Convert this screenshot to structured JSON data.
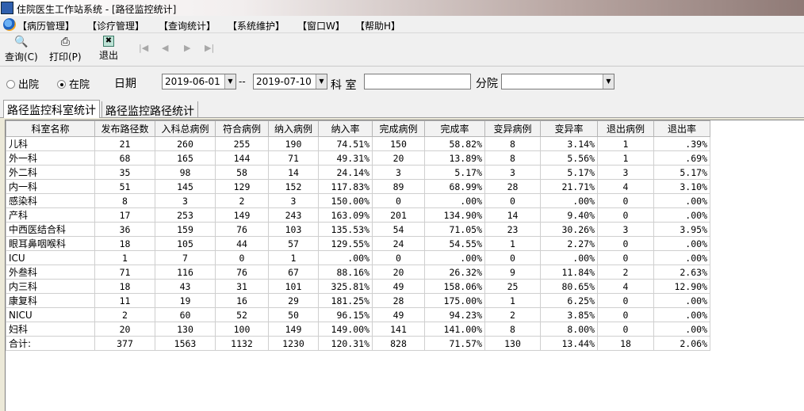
{
  "window": {
    "title": "住院医生工作站系统 - [路径监控统计]"
  },
  "menu": [
    "【病历管理】",
    "【诊疗管理】",
    "【查询统计】",
    "【系统维护】",
    "【窗口W】",
    "【帮助H】"
  ],
  "toolbar": {
    "query_label": "查询(C)",
    "print_label": "打印(P)",
    "exit_label": "退出"
  },
  "filters": {
    "radio_out": "出院",
    "radio_in": "在院",
    "date_label": "日期",
    "date_from": "2019-06-01",
    "date_sep": "--",
    "date_to": "2019-07-10",
    "dept_label": "科 室",
    "dept_value": "",
    "branch_label": "分院",
    "branch_value": ""
  },
  "tabs": [
    "路径监控科室统计",
    "路径监控路径统计"
  ],
  "table": {
    "columns": [
      "科室名称",
      "发布路径数",
      "入科总病例",
      "符合病例",
      "纳入病例",
      "纳入率",
      "完成病例",
      "完成率",
      "变异病例",
      "变异率",
      "退出病例",
      "退出率"
    ],
    "rows": [
      [
        "儿科",
        "21",
        "260",
        "255",
        "190",
        "74.51%",
        "150",
        "58.82%",
        "8",
        "3.14%",
        "1",
        ".39%"
      ],
      [
        "外一科",
        "68",
        "165",
        "144",
        "71",
        "49.31%",
        "20",
        "13.89%",
        "8",
        "5.56%",
        "1",
        ".69%"
      ],
      [
        "外二科",
        "35",
        "98",
        "58",
        "14",
        "24.14%",
        "3",
        "5.17%",
        "3",
        "5.17%",
        "3",
        "5.17%"
      ],
      [
        "内一科",
        "51",
        "145",
        "129",
        "152",
        "117.83%",
        "89",
        "68.99%",
        "28",
        "21.71%",
        "4",
        "3.10%"
      ],
      [
        "感染科",
        "8",
        "3",
        "2",
        "3",
        "150.00%",
        "0",
        ".00%",
        "0",
        ".00%",
        "0",
        ".00%"
      ],
      [
        "产科",
        "17",
        "253",
        "149",
        "243",
        "163.09%",
        "201",
        "134.90%",
        "14",
        "9.40%",
        "0",
        ".00%"
      ],
      [
        "中西医结合科",
        "36",
        "159",
        "76",
        "103",
        "135.53%",
        "54",
        "71.05%",
        "23",
        "30.26%",
        "3",
        "3.95%"
      ],
      [
        "眼耳鼻咽喉科",
        "18",
        "105",
        "44",
        "57",
        "129.55%",
        "24",
        "54.55%",
        "1",
        "2.27%",
        "0",
        ".00%"
      ],
      [
        "ICU",
        "1",
        "7",
        "0",
        "1",
        ".00%",
        "0",
        ".00%",
        "0",
        ".00%",
        "0",
        ".00%"
      ],
      [
        "外叁科",
        "71",
        "116",
        "76",
        "67",
        "88.16%",
        "20",
        "26.32%",
        "9",
        "11.84%",
        "2",
        "2.63%"
      ],
      [
        "内三科",
        "18",
        "43",
        "31",
        "101",
        "325.81%",
        "49",
        "158.06%",
        "25",
        "80.65%",
        "4",
        "12.90%"
      ],
      [
        "康复科",
        "11",
        "19",
        "16",
        "29",
        "181.25%",
        "28",
        "175.00%",
        "1",
        "6.25%",
        "0",
        ".00%"
      ],
      [
        "NICU",
        "2",
        "60",
        "52",
        "50",
        "96.15%",
        "49",
        "94.23%",
        "2",
        "3.85%",
        "0",
        ".00%"
      ],
      [
        "妇科",
        "20",
        "130",
        "100",
        "149",
        "149.00%",
        "141",
        "141.00%",
        "8",
        "8.00%",
        "0",
        ".00%"
      ],
      [
        "合计:",
        "377",
        "1563",
        "1132",
        "1230",
        "120.31%",
        "828",
        "71.57%",
        "130",
        "13.44%",
        "18",
        "2.06%"
      ]
    ]
  }
}
